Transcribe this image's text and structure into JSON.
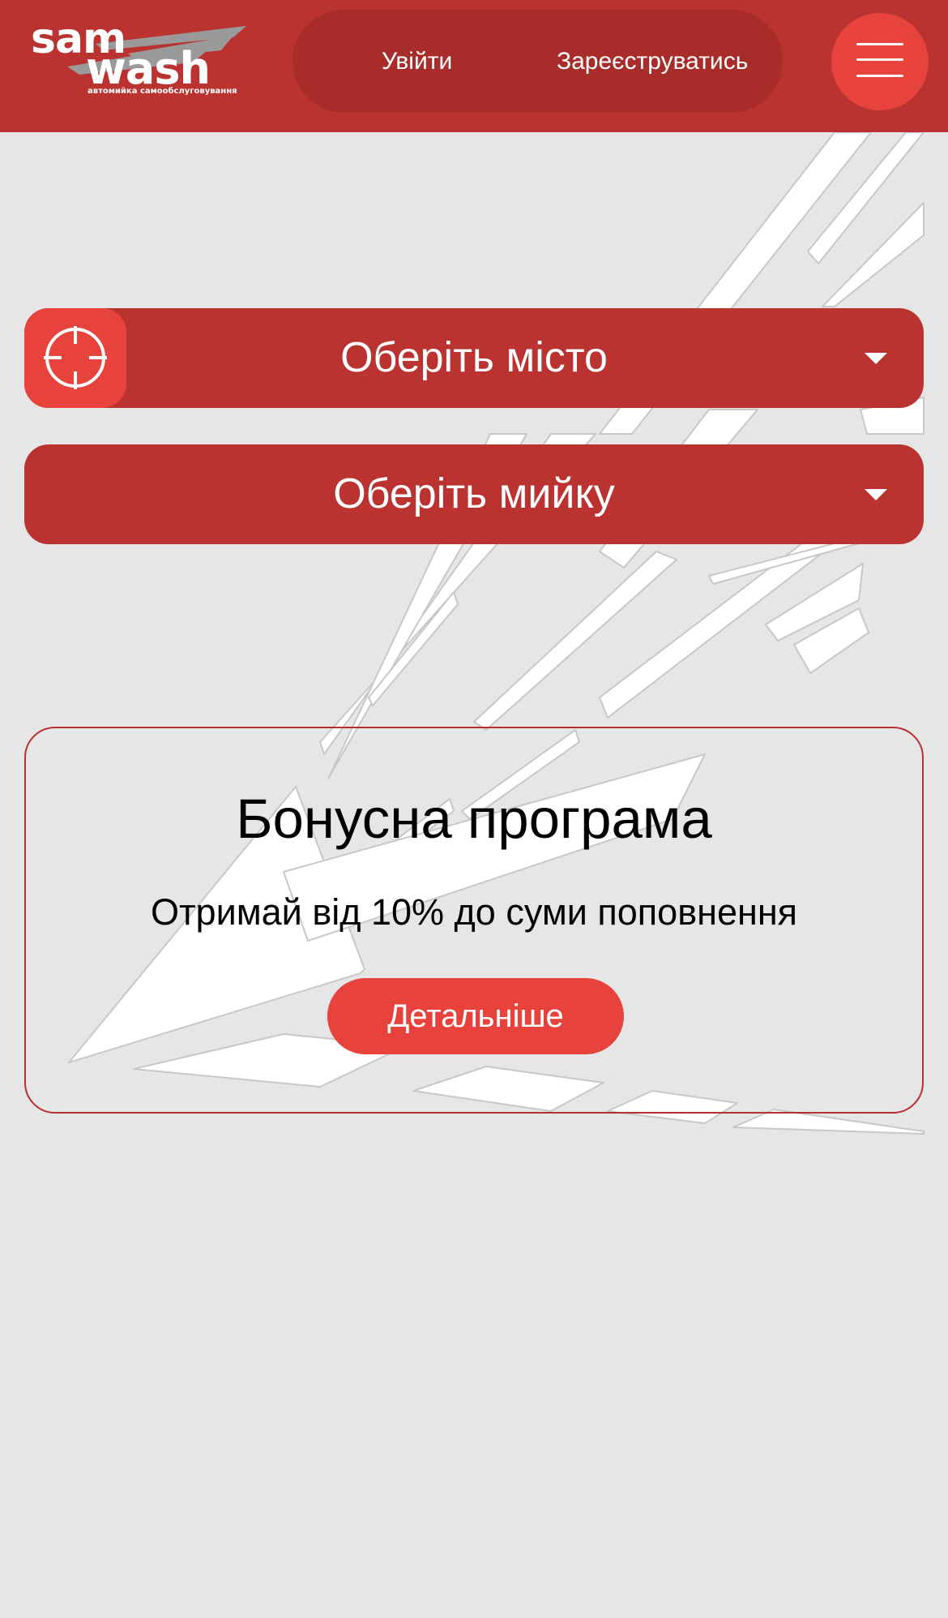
{
  "colors": {
    "header_bg": "#bb3330",
    "pill_bg": "#a82c29",
    "accent": "#e8423c",
    "page_bg": "#e6e6e6",
    "card_border": "#b8302d"
  },
  "header": {
    "logo": {
      "line1": "sam",
      "line2": "wash",
      "tagline": "автомийка самообслуговування"
    },
    "login_label": "Увійти",
    "register_label": "Зареєструватись",
    "menu_icon": "hamburger-icon"
  },
  "main": {
    "city_select": {
      "label": "Оберіть місто",
      "locate_icon": "crosshair-icon",
      "caret_icon": "caret-down-icon"
    },
    "wash_select": {
      "label": "Оберіть мийку",
      "caret_icon": "caret-down-icon"
    },
    "bonus": {
      "title": "Бонусна програма",
      "subtitle": "Отримай від 10% до суми поповнення",
      "button_label": "Детальніше"
    }
  }
}
